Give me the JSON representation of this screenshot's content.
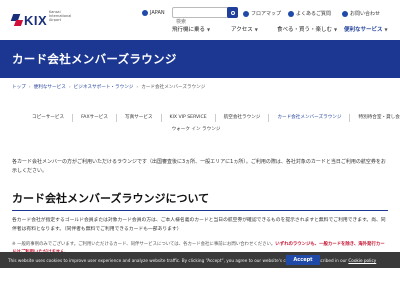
{
  "header": {
    "logo": "KIX",
    "logo_sub": "Kansai International Airport",
    "language": "JAPAN",
    "search_placeholder": "検索",
    "utilities": [
      "フロアマップ",
      "よくあるご質問",
      "お問い合わせ"
    ],
    "nav": [
      "飛行機に乗る",
      "アクセス",
      "食べる・買う・楽しむ",
      "便利なサービス"
    ]
  },
  "hero": {
    "title": "カード会社メンバーズラウンジ"
  },
  "breadcrumb": [
    "トップ",
    "便利なサービス",
    "ビジネスサポート・ラウンジ",
    "カード会社メンバーズラウンジ"
  ],
  "subnav": {
    "row1": [
      "コピーサービス",
      "FAXサービス",
      "写真サービス",
      "KIX VIP SERVICE",
      "航空会社ラウンジ",
      "カード会社メンバーズラウンジ",
      "特別待合室・貸し会議室"
    ],
    "row2": [
      "ウォーク イン ラウンジ"
    ]
  },
  "intro": "各カード会社メンバーの方がご利用いただけるラウンジです（出国審査後に3ヵ所、一般エリアに1ヵ所）。ご利用の際は、各社対象のカードと当日ご利用の航空券をお示しください。",
  "section_title": "カード会社メンバーズラウンジについて",
  "section_body": "各カード会社が指定するゴールド会員または対象カード会員の方は、ご本人様名義のカードと当日の航空券が確認できるものを提示されますと無料でご利用できます。尚、同伴者は有料となります。（同伴者も無料でご利用できるカードも一部あります）",
  "notice": {
    "text": "※ 一般的事例のみでございます。ご利用いただけるカード、同伴サービスについては、各カード会社に事前にお問い合わせください。",
    "highlight": "いずれのラウンジも、一般カードを除き、海外発行カードはご利用いただけません。"
  },
  "cookie": {
    "text": "This website uses cookies to improve user experience and analyze website traffic. By clicking “Accept“, you agree to our website's cookie use as described in our",
    "link": "Cookie policy",
    "button": "Accept"
  },
  "colors": {
    "brand_navy": "#1c3791",
    "accent_red": "#c4102e",
    "cookie_bg": "#3a3a3a",
    "button_blue": "#1f4aa8"
  }
}
